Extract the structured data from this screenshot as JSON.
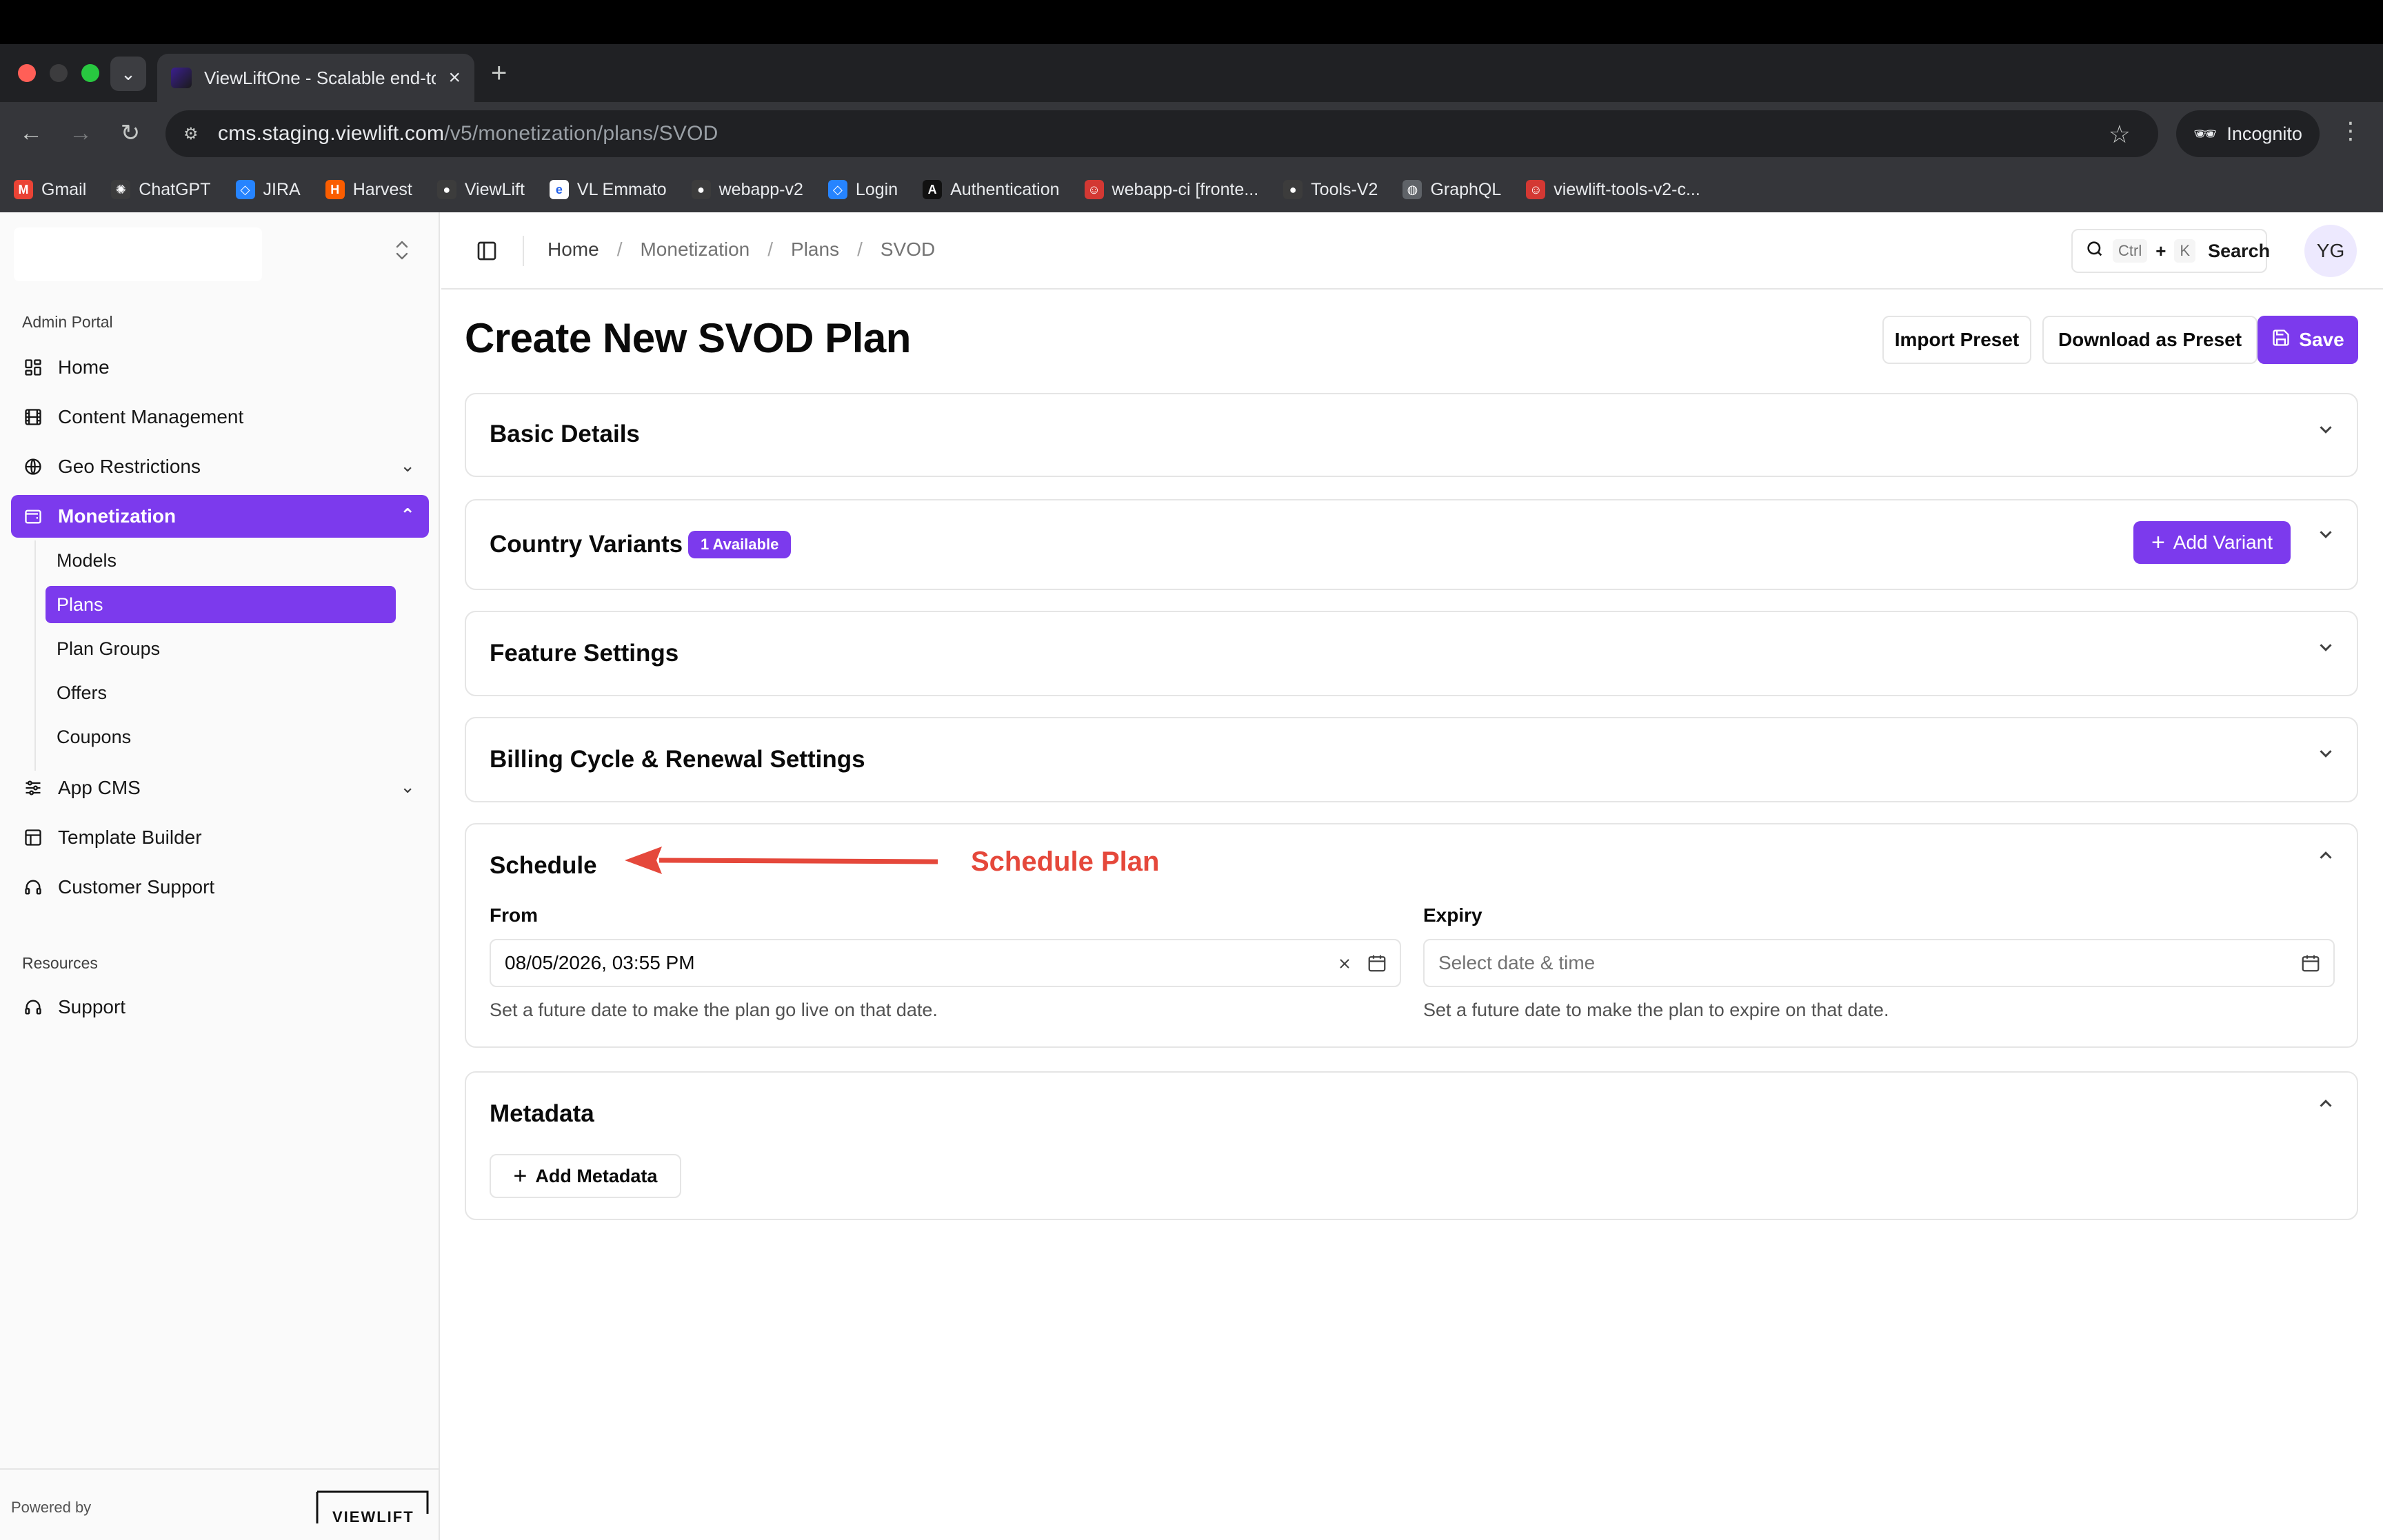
{
  "browser": {
    "tab_title": "ViewLiftOne - Scalable end-to-end",
    "url_host": "cms.staging.viewlift.com",
    "url_path": "/v5/monetization/plans/SVOD",
    "incognito_label": "Incognito",
    "bookmarks": [
      {
        "label": "Gmail",
        "icon": "gmail-icon",
        "color": "#ea4335"
      },
      {
        "label": "ChatGPT",
        "icon": "chatgpt-icon",
        "color": "#3c3c3c"
      },
      {
        "label": "JIRA",
        "icon": "jira-icon",
        "color": "#2684ff"
      },
      {
        "label": "Harvest",
        "icon": "harvest-icon",
        "color": "#fa5d00"
      },
      {
        "label": "ViewLift",
        "icon": "github-icon",
        "color": "#3c3c3c"
      },
      {
        "label": "VL Emmato",
        "icon": "emmato-icon",
        "color": "#ffffff"
      },
      {
        "label": "webapp-v2",
        "icon": "github-icon",
        "color": "#3c3c3c"
      },
      {
        "label": "Login",
        "icon": "jira-icon",
        "color": "#2684ff"
      },
      {
        "label": "Authentication",
        "icon": "auth-icon",
        "color": "#111111"
      },
      {
        "label": "webapp-ci [fronte...",
        "icon": "jenkins-icon",
        "color": "#d33833"
      },
      {
        "label": "Tools-V2",
        "icon": "github-icon",
        "color": "#3c3c3c"
      },
      {
        "label": "GraphQL",
        "icon": "globe-icon",
        "color": "#5f6368"
      },
      {
        "label": "viewlift-tools-v2-c...",
        "icon": "jenkins-icon",
        "color": "#d33833"
      }
    ]
  },
  "sidebar": {
    "group_admin": "Admin Portal",
    "items": [
      {
        "label": "Home",
        "icon": "dashboard-icon"
      },
      {
        "label": "Content Management",
        "icon": "film-icon"
      },
      {
        "label": "Geo Restrictions",
        "icon": "globe-icon"
      },
      {
        "label": "Monetization",
        "icon": "wallet-icon"
      },
      {
        "label": "App CMS",
        "icon": "sliders-icon"
      },
      {
        "label": "Template Builder",
        "icon": "layout-icon"
      },
      {
        "label": "Customer Support",
        "icon": "headset-icon"
      }
    ],
    "sub_items": [
      "Models",
      "Plans",
      "Plan Groups",
      "Offers",
      "Coupons"
    ],
    "group_resources": "Resources",
    "support": "Support",
    "powered_by": "Powered by",
    "brand": "VIEWLIFT"
  },
  "header": {
    "breadcrumbs": [
      "Home",
      "Monetization",
      "Plans",
      "SVOD"
    ],
    "search_kbd_ctrl": "Ctrl",
    "search_kbd_plus": "+",
    "search_kbd_k": "K",
    "search_label": "Search",
    "avatar_initials": "YG"
  },
  "main": {
    "title": "Create New SVOD Plan",
    "import_preset": "Import Preset",
    "download_preset": "Download as Preset",
    "save": "Save",
    "sections": {
      "basic_details": "Basic Details",
      "country_variants": "Country Variants",
      "country_variants_badge": "1 Available",
      "add_variant": "Add Variant",
      "feature_settings": "Feature Settings",
      "billing_cycle": "Billing Cycle & Renewal Settings",
      "schedule": "Schedule",
      "metadata": "Metadata",
      "add_metadata": "Add Metadata"
    },
    "schedule": {
      "from_label": "From",
      "from_value": "08/05/2026, 03:55 PM",
      "from_help": "Set a future date to make the plan go live on that date.",
      "expiry_label": "Expiry",
      "expiry_placeholder": "Select date & time",
      "expiry_help": "Set a future date to make the plan to expire on that date."
    },
    "annotation": "Schedule Plan"
  },
  "colors": {
    "accent": "#7c3aed",
    "annotation": "#e5483b"
  }
}
